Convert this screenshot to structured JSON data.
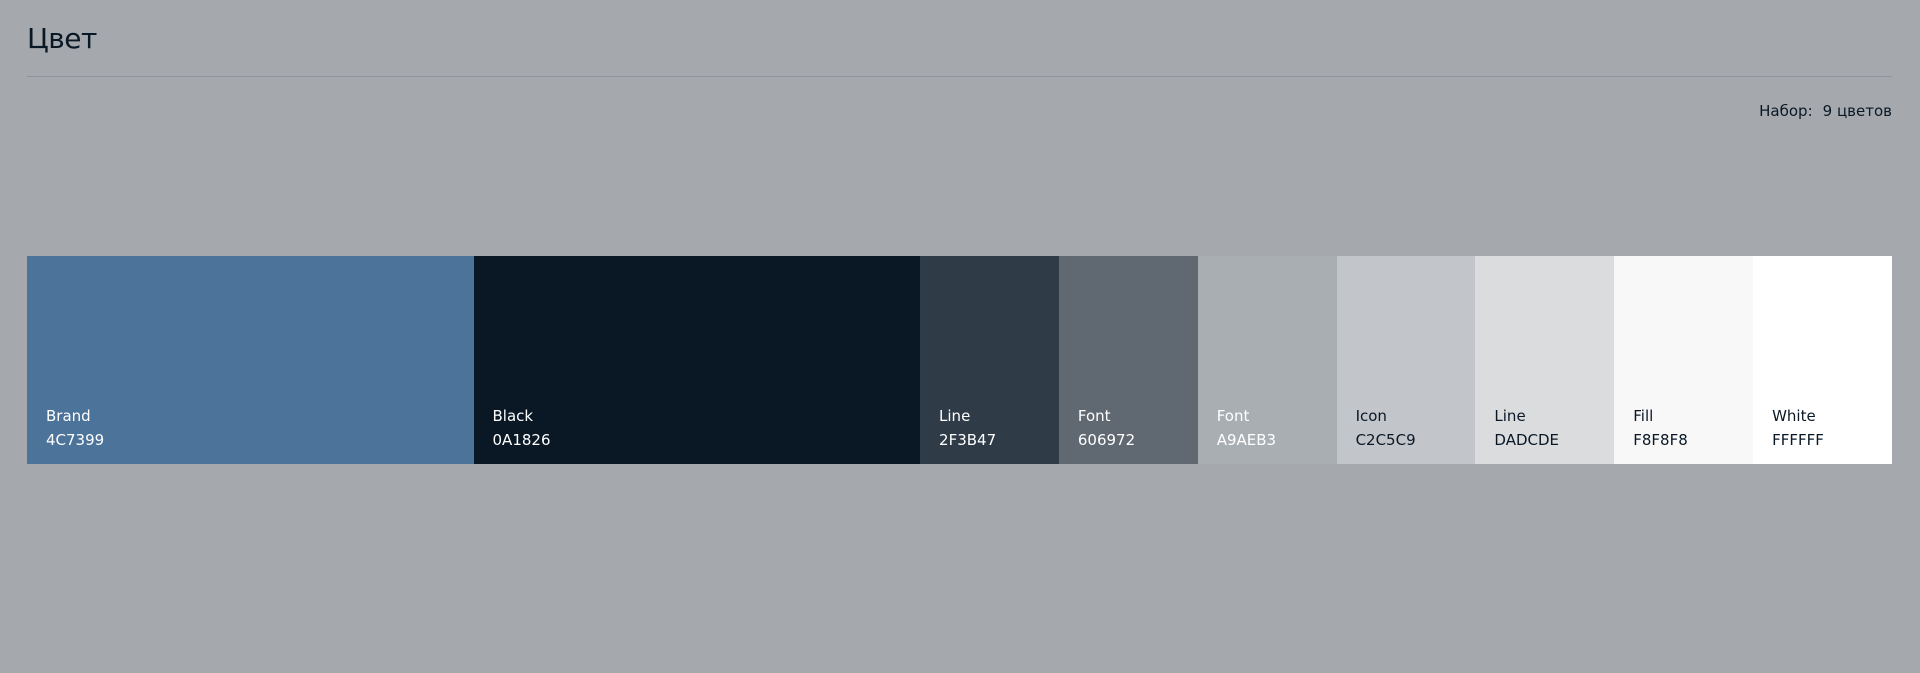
{
  "header": {
    "title": "Цвет"
  },
  "set": {
    "label": "Набор:",
    "count": "9 цветов"
  },
  "swatches": [
    {
      "name": "Brand",
      "hex": "4C7399",
      "color": "#4C7399",
      "text_color": "#FFFFFF"
    },
    {
      "name": "Black",
      "hex": "0A1826",
      "color": "#0A1826",
      "text_color": "#FFFFFF"
    },
    {
      "name": "Line",
      "hex": "2F3B47",
      "color": "#2F3B47",
      "text_color": "#FFFFFF"
    },
    {
      "name": "Font",
      "hex": "606972",
      "color": "#606972",
      "text_color": "#FFFFFF"
    },
    {
      "name": "Font",
      "hex": "A9AEB3",
      "color": "#A9AEB3",
      "text_color": "#FFFFFF"
    },
    {
      "name": "Icon",
      "hex": "C2C5C9",
      "color": "#C2C5C9",
      "text_color": "#0A1826"
    },
    {
      "name": "Line",
      "hex": "DADCDE",
      "color": "#DADCDE",
      "text_color": "#0A1826"
    },
    {
      "name": "Fill",
      "hex": "F8F8F8",
      "color": "#F8F8F8",
      "text_color": "#0A1826"
    },
    {
      "name": "White",
      "hex": "FFFFFF",
      "color": "#FFFFFF",
      "text_color": "#0A1826"
    }
  ]
}
